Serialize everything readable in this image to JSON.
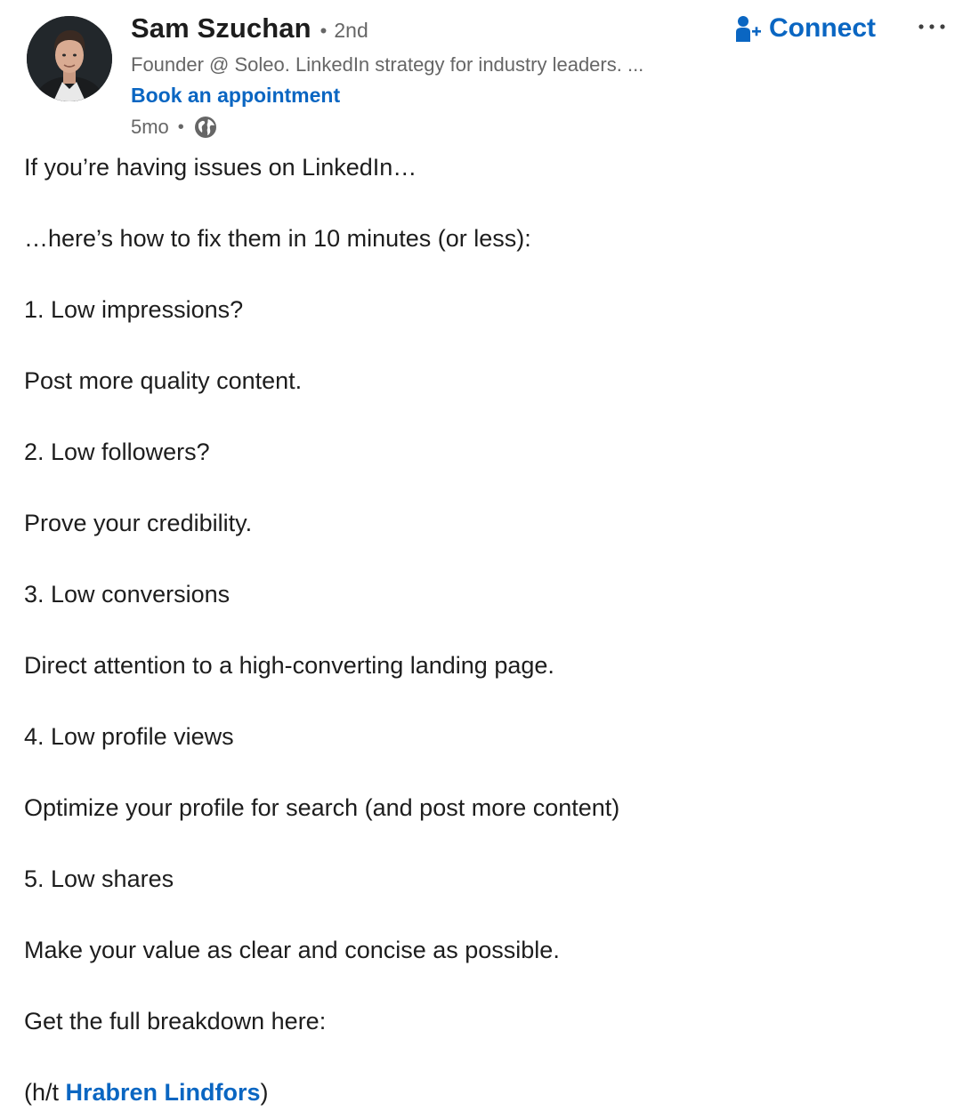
{
  "author": {
    "name": "Sam Szuchan",
    "degree_separator": "•",
    "degree": "2nd",
    "headline": "Founder @ Soleo. LinkedIn strategy for industry leaders. ...",
    "cta": "Book an appointment",
    "timestamp": "5mo",
    "time_separator": "•",
    "visibility_icon": "globe-icon"
  },
  "actions": {
    "connect_label": "Connect",
    "connect_icon": "add-person-icon",
    "more_icon": "more-options-icon"
  },
  "post": {
    "lines": [
      "If you’re having issues on LinkedIn…",
      "…here’s how to fix them in 10 minutes (or less):",
      "1. Low impressions?",
      "Post more quality content.",
      "2. Low followers?",
      "Prove your credibility.",
      "3. Low conversions",
      "Direct attention to a high-converting landing page.",
      "4. Low profile views",
      "Optimize your profile for search (and post more content)",
      "5. Low shares",
      "Make your value as clear and concise as possible.",
      "Get the full breakdown here:"
    ],
    "final_prefix": "(h/t ",
    "final_mention": "Hrabren Lindfors",
    "final_suffix": ")"
  },
  "colors": {
    "link": "#0a66c2",
    "text": "#1d1d1d",
    "muted": "#666666"
  }
}
